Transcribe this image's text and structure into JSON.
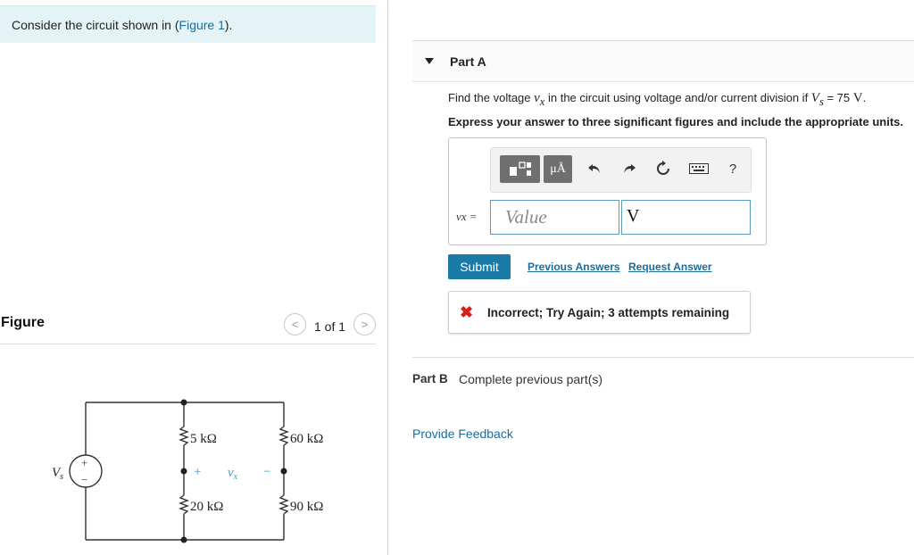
{
  "prompt": {
    "text_before": "Consider the circuit shown in (",
    "link": "Figure 1",
    "text_after": ")."
  },
  "figure": {
    "label": "Figure",
    "prev_glyph": "<",
    "next_glyph": ">",
    "counter": "1 of 1",
    "circuit": {
      "source_label": "V",
      "source_subscript": "s",
      "source_plus": "+",
      "source_minus": "−",
      "r1": "5 kΩ",
      "r2": "20 kΩ",
      "r3": "60 kΩ",
      "r4": "90 kΩ",
      "vx_plus": "+",
      "vx_label": "v",
      "vx_subscript": "x",
      "vx_minus": "−"
    }
  },
  "part_a": {
    "title": "Part A",
    "question_pre": "Find the voltage ",
    "question_var": "v",
    "question_var_sub": "x",
    "question_mid": " in the circuit using voltage and/or current division if ",
    "question_vs": "V",
    "question_vs_sub": "s",
    "question_eq": " = 75 ",
    "question_unit": "V",
    "question_end": ".",
    "instruction": "Express your answer to three significant figures and include the appropriate units.",
    "toolbar": {
      "units_label": "μÅ",
      "help_label": "?"
    },
    "answer_label": "vx =",
    "value_placeholder": "Value",
    "unit_value": "V",
    "submit_label": "Submit",
    "previous_answers": "Previous Answers",
    "request_answer": "Request Answer",
    "feedback_icon": "✖",
    "feedback": "Incorrect; Try Again; 3 attempts remaining"
  },
  "part_b": {
    "label": "Part B",
    "note": "Complete previous part(s)"
  },
  "provide_feedback": "Provide Feedback",
  "colors": {
    "accent": "#1a7aa8",
    "link": "#1a6da0",
    "error": "#d2221a",
    "prompt_bg": "#e4f4f6"
  }
}
